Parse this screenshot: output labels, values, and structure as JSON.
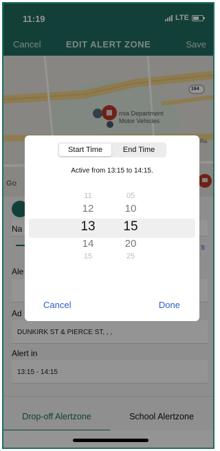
{
  "status_bar": {
    "time": "11:19",
    "network": "LTE"
  },
  "nav": {
    "cancel": "Cancel",
    "title": "EDIT ALERT ZONE",
    "save": "Save"
  },
  "map": {
    "place_label_line1": "rnia Department",
    "place_label_line2": "Motor Vehicles",
    "route_badge": "164",
    "edge_text": "Ra",
    "google_text": "Go"
  },
  "form": {
    "name_label": "Na",
    "link_text": "s",
    "alert_label": "Ale",
    "address_label": "Ad",
    "address_value": "DUNKIRK ST & PIERCE ST, , ,",
    "alert_in_label": "Alert in",
    "alert_in_value": "13:15 - 14:15"
  },
  "tabs": {
    "dropoff": "Drop-off Alertzone",
    "school": "School Alertzone"
  },
  "dialog": {
    "segments": {
      "start": "Start Time",
      "end": "End Time"
    },
    "active_text": "Active from 13:15 to 14:15.",
    "hours": [
      "11",
      "12",
      "13",
      "14",
      "15"
    ],
    "minutes": [
      "05",
      "10",
      "15",
      "20",
      "25"
    ],
    "cancel": "Cancel",
    "done": "Done"
  },
  "colors": {
    "primary": "#1f6e63",
    "accent_link": "#2a5ec9",
    "pin": "#c0392b"
  }
}
